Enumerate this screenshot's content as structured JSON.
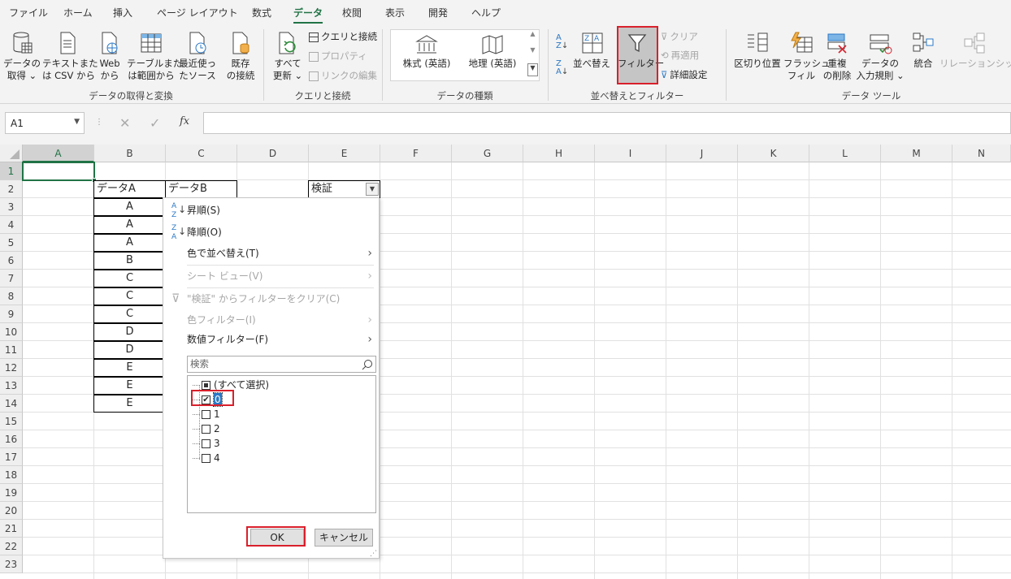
{
  "menu_tabs": [
    "ファイル",
    "ホーム",
    "挿入",
    "ページ レイアウト",
    "数式",
    "データ",
    "校閲",
    "表示",
    "開発",
    "ヘルプ"
  ],
  "ribbon": {
    "get_data": {
      "label1": "データの",
      "label2": "取得 ⌄"
    },
    "text_csv": {
      "label1": "テキストまた",
      "label2": "は CSV から"
    },
    "web": {
      "label1": "Web",
      "label2": "から"
    },
    "table_range": {
      "label1": "テーブルまた",
      "label2": "は範囲から"
    },
    "recent_sources": {
      "label1": "最近使っ",
      "label2": "たソース"
    },
    "existing_conn": {
      "label1": "既存",
      "label2": "の接続"
    },
    "group1": "データの取得と変換",
    "refresh_all": {
      "label1": "すべて",
      "label2": "更新 ⌄"
    },
    "queries_connections": "クエリと接続",
    "properties": "プロパティ",
    "edit_links": "リンクの編集",
    "group2": "クエリと接続",
    "stocks": "株式 (英語)",
    "geography": "地理 (英語)",
    "group3": "データの種類",
    "sort": "並べ替え",
    "filter": "フィルター",
    "clear": "クリア",
    "reapply": "再適用",
    "advanced": "詳細設定",
    "group4": "並べ替えとフィルター",
    "text_to_columns": "区切り位置",
    "flash_fill": {
      "label1": "フラッシュ",
      "label2": "フィル"
    },
    "remove_dup": {
      "label1": "重複",
      "label2": "の削除"
    },
    "data_validation": {
      "label1": "データの",
      "label2": "入力規則 ⌄"
    },
    "consolidate": "統合",
    "relationships": "リレーションシップ",
    "group5": "データ ツール"
  },
  "formula_bar": {
    "name_box": "A1",
    "fx": "fx",
    "formula": ""
  },
  "columns": [
    "A",
    "B",
    "C",
    "D",
    "E",
    "F",
    "G",
    "H",
    "I",
    "J",
    "K",
    "L",
    "M",
    "N"
  ],
  "rows": [
    "1",
    "2",
    "3",
    "4",
    "5",
    "6",
    "7",
    "8",
    "9",
    "10",
    "11",
    "12",
    "13",
    "14",
    "15",
    "16",
    "17",
    "18",
    "19",
    "20",
    "21",
    "22",
    "23"
  ],
  "cells": {
    "B2": "データA",
    "C2": "データB",
    "E2": "検証",
    "B_values": [
      "A",
      "A",
      "A",
      "B",
      "C",
      "C",
      "C",
      "D",
      "D",
      "E",
      "E",
      "E"
    ]
  },
  "dropdown": {
    "sort_asc": "昇順(S)",
    "sort_desc": "降順(O)",
    "sort_by_color": "色で並べ替え(T)",
    "sheet_view": "シート ビュー(V)",
    "clear_filter": "\"検証\" からフィルターをクリア(C)",
    "color_filter": "色フィルター(I)",
    "number_filter": "数値フィルター(F)",
    "search_placeholder": "検索",
    "items": [
      "(すべて選択)",
      "0",
      "1",
      "2",
      "3",
      "4"
    ],
    "ok": "OK",
    "cancel": "キャンセル"
  },
  "colors": {
    "accent": "#217346",
    "highlight": "#d9202c"
  }
}
